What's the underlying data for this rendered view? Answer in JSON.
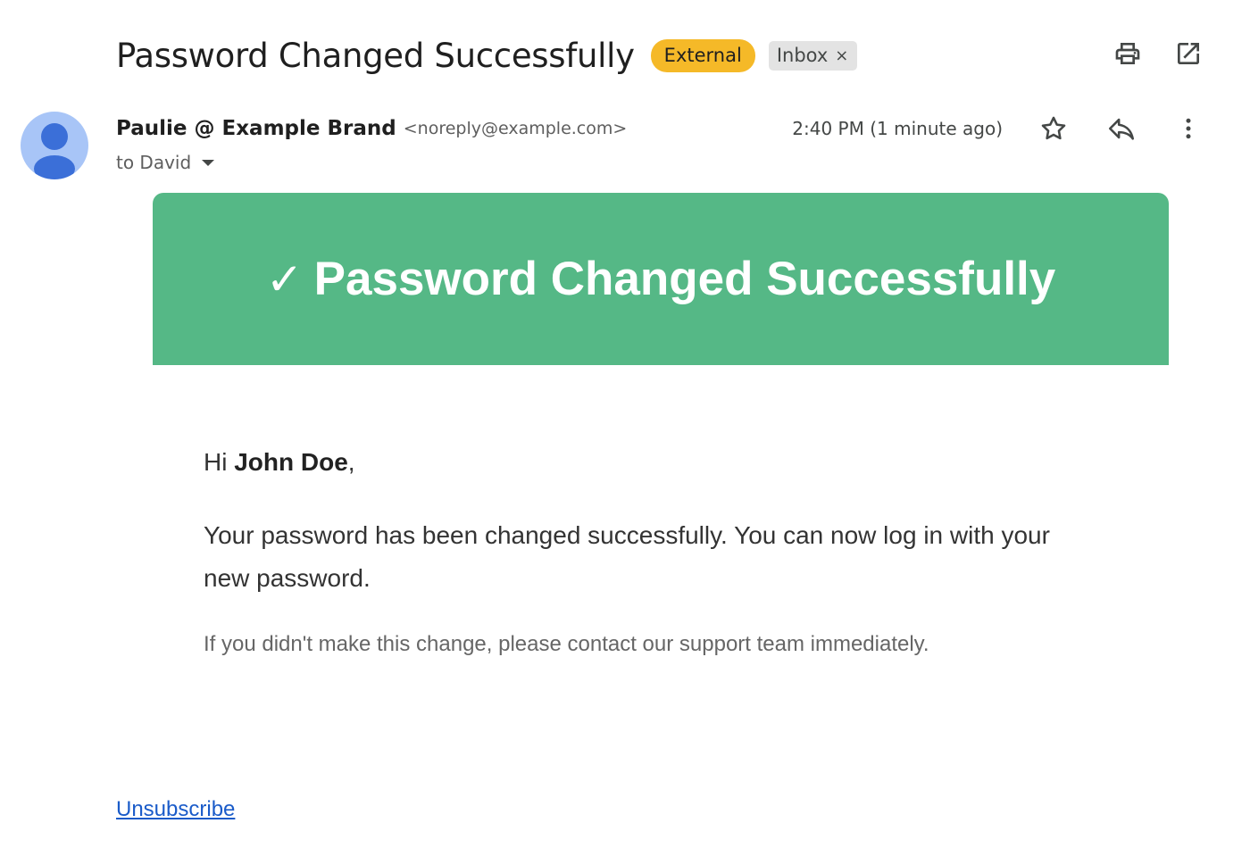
{
  "email": {
    "subject": "Password Changed Successfully",
    "labels": {
      "external": "External",
      "inbox": "Inbox",
      "inbox_remove": "×"
    },
    "sender": {
      "name": "Paulie @ Example Brand",
      "email": "<noreply@example.com>",
      "recipient_line": "to David",
      "timestamp": "2:40 PM (1 minute ago)"
    },
    "actions": {
      "print_icon": "print-icon",
      "open_new_window_icon": "open-in-new-window-icon",
      "star_icon": "star-icon",
      "reply_icon": "reply-icon",
      "more_icon": "more-vert-icon"
    }
  },
  "message": {
    "banner": {
      "check": "✓",
      "title": "Password Changed Successfully",
      "color": "#55b886"
    },
    "greeting_prefix": "Hi ",
    "greeting_name": "John Doe",
    "greeting_suffix": ",",
    "body": "Your password has been changed successfully. You can now log in with your new password.",
    "note": "If you didn't make this change, please contact our support team immediately.",
    "unsubscribe": "Unsubscribe"
  },
  "colors": {
    "external_badge": "#f5b928",
    "inbox_badge": "#e3e3e3",
    "avatar": "#a8c5f7",
    "avatar_figure": "#3b6fd8",
    "link": "#1a5bc9"
  }
}
